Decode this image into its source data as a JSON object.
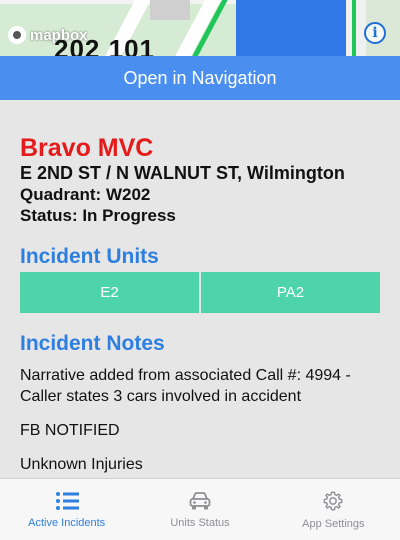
{
  "map": {
    "logo_text": "mapbox",
    "visible_number": "202 101"
  },
  "nav_button_label": "Open in Navigation",
  "incident": {
    "title": "Bravo MVC",
    "address": "E 2ND ST / N WALNUT ST, Wilmington",
    "quadrant": "Quadrant: W202",
    "status": "Status: In Progress"
  },
  "units_section": {
    "title": "Incident Units",
    "units": [
      "E2",
      "PA2"
    ]
  },
  "notes_section": {
    "title": "Incident Notes",
    "notes": [
      "Narrative added from associated Call #: 4994 - Caller states 3 cars involved in accident",
      "FB NOTIFIED",
      "Unknown Injuries"
    ]
  },
  "tabs": [
    {
      "label": "Active Incidents",
      "icon": "list-icon",
      "active": true
    },
    {
      "label": "Units Status",
      "icon": "car-icon",
      "active": false
    },
    {
      "label": "App Settings",
      "icon": "gear-icon",
      "active": false
    }
  ],
  "colors": {
    "accent_blue": "#2d7fe0",
    "nav_bar": "#4a8ef0",
    "incident_red": "#e51b1b",
    "unit_green": "#4ed4a9"
  }
}
